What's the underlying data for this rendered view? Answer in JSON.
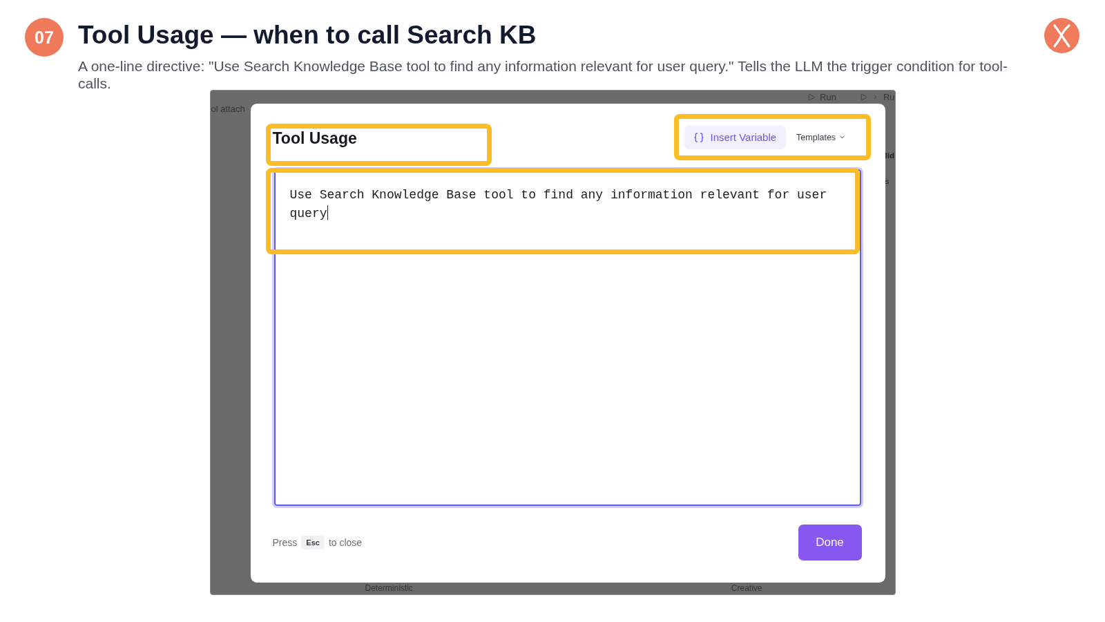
{
  "slide": {
    "number": "07",
    "title": "Tool Usage — when to call Search KB",
    "subtitle": "A one-line directive: \"Use Search Knowledge Base tool to find any information relevant for user query.\" Tells the LLM the trigger condition for tool-calls."
  },
  "screenshot": {
    "background": {
      "run_buttons": [
        "Run",
        "Ru"
      ],
      "left_label": "ol attach",
      "right_texts": [
        "lid",
        "s"
      ],
      "bottom_labels": [
        "Deterministic",
        "Creative"
      ]
    },
    "modal": {
      "title": {
        "text": "Tool Usage",
        "highlighted": true
      },
      "toolbar": {
        "highlighted": true,
        "insert_button": "Insert Variable",
        "templates_menu": "Templates"
      },
      "editor": {
        "value": "Use Search Knowledge Base tool to find any information relevant for user query",
        "focused": true,
        "highlighted": true
      },
      "footer": {
        "hint_before": "Press",
        "key": "Esc",
        "hint_after": "to close",
        "done_button": "Done"
      }
    }
  }
}
